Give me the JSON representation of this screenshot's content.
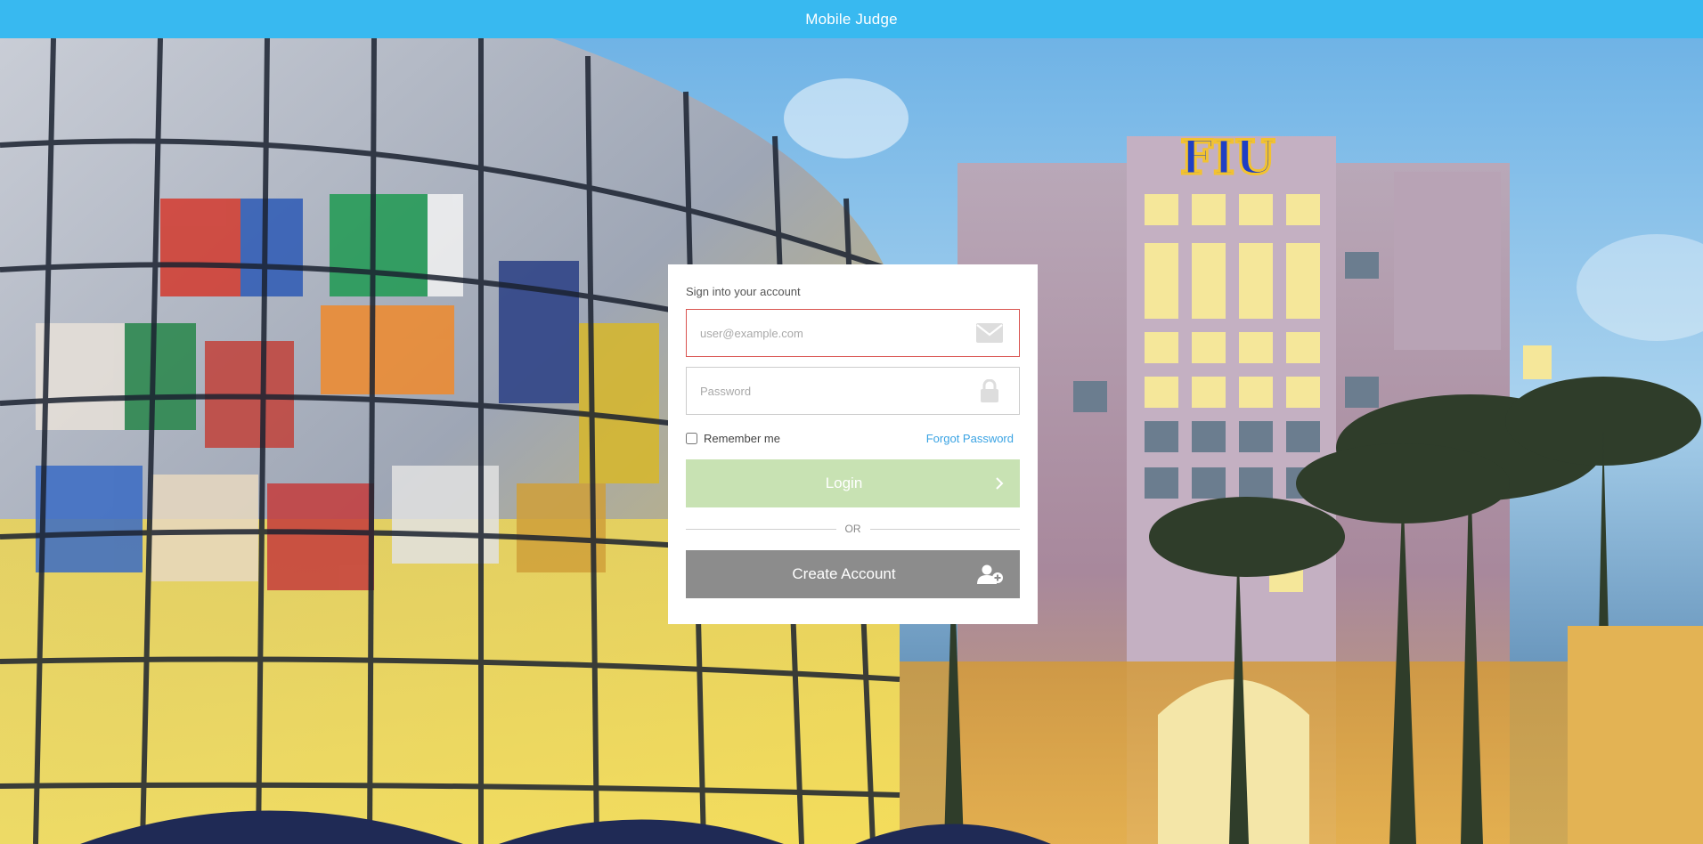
{
  "app": {
    "title": "Mobile Judge"
  },
  "background": {
    "description_icon": "campus-photo",
    "sign_text": "FIU"
  },
  "login": {
    "heading": "Sign into your account",
    "email": {
      "placeholder": "user@example.com",
      "value": "",
      "icon": "envelope-icon"
    },
    "password": {
      "placeholder": "Password",
      "value": "",
      "icon": "lock-icon"
    },
    "remember_label": "Remember me",
    "remember_checked": false,
    "forgot_label": "Forgot Password",
    "login_label": "Login",
    "login_icon": "chevron-right-icon",
    "divider_label": "OR",
    "create_label": "Create Account",
    "create_icon": "add-user-icon"
  },
  "colors": {
    "topbar": "#38b9f0",
    "login_button": "#c8e2b3",
    "create_button": "#8c8c8c",
    "error_border": "#d9534f",
    "link": "#3aa3e3"
  }
}
